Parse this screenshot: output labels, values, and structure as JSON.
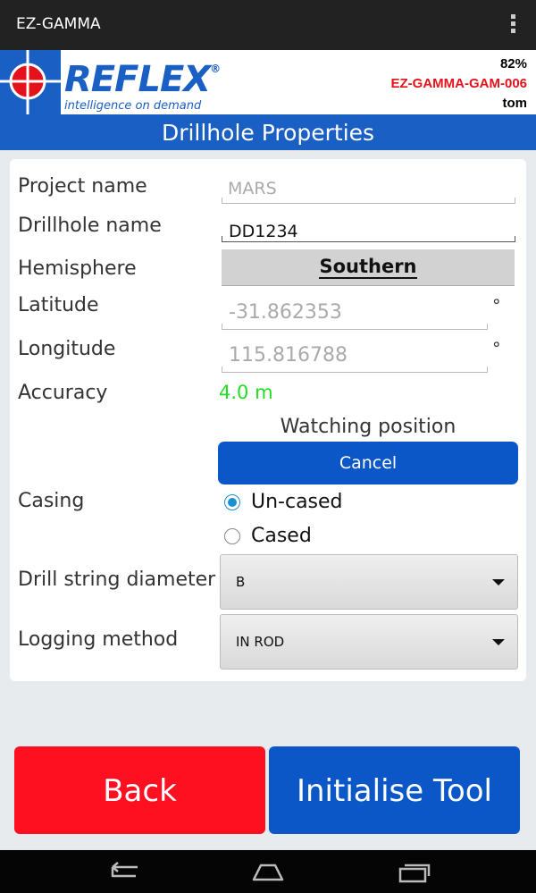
{
  "app_title": "EZ-GAMMA",
  "header": {
    "brand": "REFLEX",
    "trademark": "®",
    "tagline": "intelligence on demand",
    "battery": "82%",
    "device": "EZ-GAMMA-GAM-006",
    "user": "tom"
  },
  "page_title": "Drillhole Properties",
  "form": {
    "project_name": {
      "label": "Project name",
      "placeholder": "MARS"
    },
    "drillhole_name": {
      "label": "Drillhole name",
      "value": "DD1234"
    },
    "hemisphere": {
      "label": "Hemisphere",
      "value": "Southern"
    },
    "latitude": {
      "label": "Latitude",
      "placeholder": "-31.862353",
      "unit": "°"
    },
    "longitude": {
      "label": "Longitude",
      "placeholder": "115.816788",
      "unit": "°"
    },
    "accuracy": {
      "label": "Accuracy",
      "value": "4.0 m"
    },
    "position_status": "Watching position",
    "cancel_label": "Cancel",
    "casing": {
      "label": "Casing",
      "options": [
        "Un-cased",
        "Cased"
      ],
      "selected": "Un-cased"
    },
    "drill_string_diameter": {
      "label": "Drill string diameter",
      "value": "B"
    },
    "logging_method": {
      "label": "Logging method",
      "value": "IN ROD"
    }
  },
  "buttons": {
    "back": "Back",
    "initialise": "Initialise Tool"
  },
  "colors": {
    "brand_blue": "#1a5fc4",
    "accent_red": "#e3121b",
    "accuracy_green": "#22cc22",
    "back_red": "#ff1021",
    "button_blue": "#0b57c8"
  },
  "icons": [
    "overflow-menu-icon",
    "crosshair-logo-icon",
    "caret-down-icon",
    "back-icon",
    "home-icon",
    "recents-icon"
  ]
}
